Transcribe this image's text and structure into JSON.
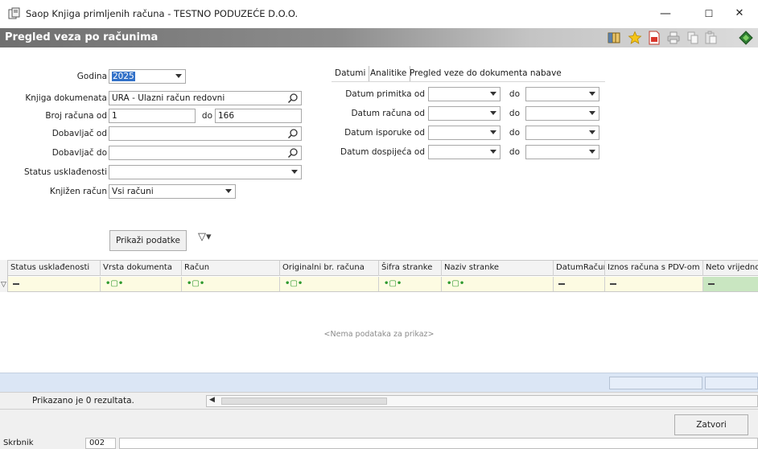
{
  "window": {
    "title": "Saop Knjiga primljenih računa - TESTNO PODUZEĆE D.O.O.",
    "minimize_glyph": "—",
    "maximize_glyph": "☐",
    "close_glyph": "✕"
  },
  "header": {
    "title": "Pregled veza po računima",
    "toolbar_icons": [
      "columns-icon",
      "star-icon",
      "pdf-icon",
      "print-icon",
      "copy-icon",
      "paste-icon",
      "exit-icon"
    ]
  },
  "form": {
    "godina": {
      "label": "Godina",
      "value": "2025"
    },
    "knjiga": {
      "label": "Knjiga dokumenata",
      "value": "URA - Ulazni račun redovni"
    },
    "broj_od": {
      "label": "Broj računa od",
      "value": "1"
    },
    "broj_do": {
      "label": "do",
      "value": "166"
    },
    "dobavljac_od": {
      "label": "Dobavljač od",
      "value": ""
    },
    "dobavljac_do": {
      "label": "Dobavljač do",
      "value": ""
    },
    "status": {
      "label": "Status usklađenosti",
      "value": ""
    },
    "knjizen": {
      "label": "Knjižen račun",
      "value": "Vsi računi"
    }
  },
  "tabs": [
    "Datumi",
    "Analitike",
    "Pregled veze do dokumenta nabave"
  ],
  "dates": {
    "do_label": "do",
    "rows": [
      {
        "label": "Datum primitka od"
      },
      {
        "label": "Datum računa od"
      },
      {
        "label": "Datum isporuke od"
      },
      {
        "label": "Datum dospijeća od"
      }
    ]
  },
  "show_button": "Prikaži podatke",
  "filter_glyph": "▽▾",
  "grid": {
    "columns": [
      "Status usklađenosti",
      "Vrsta dokumenta",
      "Račun",
      "Originalni br. računa",
      "Šifra stranke",
      "Naziv stranke",
      "DatumRačuna",
      "Iznos računa s PDV-om",
      "Neto vrijedno"
    ],
    "filter_ops": [
      "dash",
      "contains",
      "contains",
      "contains",
      "contains",
      "contains",
      "dash",
      "dash",
      "dash"
    ],
    "contains_glyph": "•▢•",
    "empty_message": "<Nema podataka za prikaz>"
  },
  "status_text": "Prikazano je 0 rezultata.",
  "scroll_left_glyph": "◀",
  "close_button": "Zatvori",
  "bottom": {
    "label": "Skrbnik",
    "value": "002"
  },
  "colors": {
    "header_dark": "#6f6f6f",
    "selection": "#3271c8",
    "filter_row": "#fdfbe2",
    "footer_band": "#dbe6f5"
  }
}
